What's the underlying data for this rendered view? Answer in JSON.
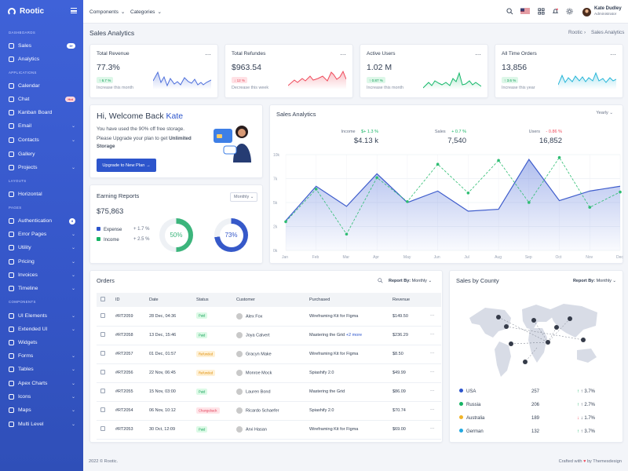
{
  "app": {
    "brand": "Rootic"
  },
  "sidebar": {
    "sections": [
      "DASHBOARDS",
      "APPLICATIONS",
      "LAYOUTS",
      "PAGES",
      "COMPONENTS"
    ],
    "items": [
      {
        "label": "Sales",
        "badge": "5+",
        "icon": "monitor-icon"
      },
      {
        "label": "Analytics",
        "icon": "chart-icon"
      },
      {
        "label": "Calendar",
        "icon": "calendar-icon"
      },
      {
        "label": "Chat",
        "badge": "Hot",
        "icon": "chat-icon"
      },
      {
        "label": "Kanban Board",
        "icon": "kanban-icon"
      },
      {
        "label": "Email",
        "icon": "mail-icon"
      },
      {
        "label": "Contacts",
        "icon": "contacts-icon"
      },
      {
        "label": "Gallery",
        "icon": "gallery-icon"
      },
      {
        "label": "Projects",
        "icon": "projects-icon"
      },
      {
        "label": "Horizontal",
        "icon": "layout-icon"
      },
      {
        "label": "Authentication",
        "badge": "8",
        "icon": "user-icon"
      },
      {
        "label": "Error Pages",
        "icon": "error-icon"
      },
      {
        "label": "Utility",
        "icon": "utility-icon"
      },
      {
        "label": "Pricing",
        "icon": "price-icon"
      },
      {
        "label": "Invoices",
        "icon": "invoice-icon"
      },
      {
        "label": "Timeline",
        "icon": "timeline-icon"
      },
      {
        "label": "UI Elements",
        "icon": "ui-icon"
      },
      {
        "label": "Extended UI",
        "icon": "extended-icon"
      },
      {
        "label": "Widgets",
        "icon": "widgets-icon"
      },
      {
        "label": "Forms",
        "icon": "forms-icon"
      },
      {
        "label": "Tables",
        "icon": "table-icon"
      },
      {
        "label": "Apex Charts",
        "icon": "apex-icon"
      },
      {
        "label": "Icons",
        "icon": "icons-icon"
      },
      {
        "label": "Maps",
        "icon": "map-icon"
      },
      {
        "label": "Multi Level",
        "icon": "share-icon"
      }
    ]
  },
  "topbar": {
    "components": "Components",
    "categories": "Categories",
    "user": {
      "name": "Kate Dudley",
      "role": "Administrator"
    }
  },
  "page": {
    "title": "Sales Analytics",
    "breadcrumb_root": "Rootic",
    "breadcrumb_current": "Sales Analytics"
  },
  "stats": [
    {
      "label": "Total Revenue",
      "value": "77.3%",
      "change": "↑ 6.7 %",
      "note": "Increase this month",
      "type": "pos",
      "color": "#4c6edb"
    },
    {
      "label": "Total Refundes",
      "value": "$963.54",
      "change": "↓ 12 %",
      "note": "Decrease this week",
      "type": "neg",
      "color": "#ef4b5c"
    },
    {
      "label": "Active Users",
      "value": "1.02 M",
      "change": "↑ 0.87 %",
      "note": "Increase this month",
      "type": "pos",
      "color": "#15b86a"
    },
    {
      "label": "All Time Orders",
      "value": "13,856",
      "change": "↑ 3.6 %",
      "note": "Increase this year",
      "type": "pos",
      "color": "#26b6d8"
    }
  ],
  "welcome": {
    "greeting": "Hi, Welcome Back ",
    "name": "Kate",
    "line1": "You have used the 90% off free storage.",
    "line2": "Please Upgrade your plan to get ",
    "bold": "Unlimited",
    "line3": "Storage",
    "button": "Upgrade to New Plan →"
  },
  "earning": {
    "title": "Earning Reports",
    "select": "Monthly",
    "amount": "$75,863",
    "legend": [
      {
        "label": "Expense",
        "value": "+ 1.7 %",
        "color": "#2d55cc"
      },
      {
        "label": "Income",
        "value": "+ 2.5 %",
        "color": "#16b364"
      }
    ],
    "donuts": [
      {
        "value": "50%",
        "color": "#3cb57c"
      },
      {
        "value": "73%",
        "color": "#3659c9"
      }
    ]
  },
  "sales": {
    "title": "Sales Analytics",
    "select": "Yearly",
    "metrics": [
      {
        "label": "Income",
        "change": "$+ 1.3 %",
        "value": "$4.13 k"
      },
      {
        "label": "Sales",
        "change": "+ 0.7 %",
        "value": "7,540"
      },
      {
        "label": "Users",
        "change": "- 0.86 %",
        "value": "16,852"
      }
    ]
  },
  "chart_data": {
    "type": "line",
    "categories": [
      "Jan",
      "Feb",
      "Mar",
      "Apr",
      "May",
      "Jun",
      "Jul",
      "Aug",
      "Sep",
      "Oct",
      "Nov",
      "Dec"
    ],
    "series": [
      {
        "values": [
          3.1,
          6.7,
          4.6,
          8.0,
          5.0,
          6.2,
          4.1,
          4.3,
          9.5,
          5.2,
          6.2,
          6.7
        ]
      },
      {
        "values": [
          3.0,
          6.4,
          1.7,
          7.6,
          5.1,
          9.0,
          6.0,
          9.4,
          5.0,
          9.7,
          4.5,
          6.1
        ]
      }
    ],
    "y_ticks": [
      "0k",
      "2k",
      "5k",
      "7k",
      "10k"
    ],
    "ylim": [
      0,
      10
    ]
  },
  "orders": {
    "title": "Orders",
    "report": "Report By:",
    "select": "Monthly",
    "columns": [
      "ID",
      "Date",
      "Status",
      "Customer",
      "Purchased",
      "Revenue"
    ],
    "rows": [
      {
        "id": "#RT2059",
        "date": "28 Dec, 04:36",
        "status": "Paid",
        "status_type": "paid",
        "customer": "Alex Fox",
        "purchased": "Wireframing Kit for Figma",
        "revenue": "$149.50"
      },
      {
        "id": "#RT2058",
        "date": "13 Dec, 15:46",
        "status": "Paid",
        "status_type": "paid",
        "customer": "Joya Calvert",
        "purchased": "Mastering the Grid",
        "extra": "+2 more",
        "revenue": "$236.29"
      },
      {
        "id": "#RT2057",
        "date": "01 Dec, 01:57",
        "status": "Refunded",
        "status_type": "ref",
        "customer": "Gracyn Make",
        "purchased": "Wireframing Kit for Figma",
        "revenue": "$8.50"
      },
      {
        "id": "#RT2056",
        "date": "22 Nov, 06:45",
        "status": "Refunded",
        "status_type": "ref",
        "customer": "Monroe Mock",
        "purchased": "Spiashify 2.0",
        "revenue": "$49.99"
      },
      {
        "id": "#RT2055",
        "date": "15 Nov, 03:00",
        "status": "Paid",
        "status_type": "paid",
        "customer": "Lauren Bond",
        "purchased": "Mastering the Grid",
        "revenue": "$86.09"
      },
      {
        "id": "#RT2054",
        "date": "06 Nov, 10:12",
        "status": "Changeback",
        "status_type": "charge",
        "customer": "Ricardo Schaefer",
        "purchased": "Spiashify 2.0",
        "revenue": "$70.74"
      },
      {
        "id": "#RT2053",
        "date": "30 Oct, 12:09",
        "status": "Paid",
        "status_type": "paid",
        "customer": "Arvi Hasan",
        "purchased": "Wireframing Kit for Figma",
        "revenue": "$69.00"
      }
    ]
  },
  "county": {
    "title": "Sales by County",
    "report": "Report By:",
    "select": "Monthly",
    "rows": [
      {
        "country": "USA",
        "value": "257",
        "change": "↑ 3.7%",
        "color": "#2d55cc",
        "arrow_color": "#16b364"
      },
      {
        "country": "Russia",
        "value": "206",
        "change": "↑ 2.7%",
        "color": "#16b364",
        "arrow_color": "#16b364"
      },
      {
        "country": "Australia",
        "value": "189",
        "change": "↓ 1.7%",
        "color": "#f0b429",
        "arrow_color": "#ef4b5c"
      },
      {
        "country": "German",
        "value": "132",
        "change": "↑ 3.7%",
        "color": "#22a8e0",
        "arrow_color": "#16b364"
      }
    ]
  },
  "footer": {
    "left": "2022 © Rootic.",
    "crafted": "Crafted with ",
    "heart": "♥",
    "by": " by Themesdesign"
  }
}
